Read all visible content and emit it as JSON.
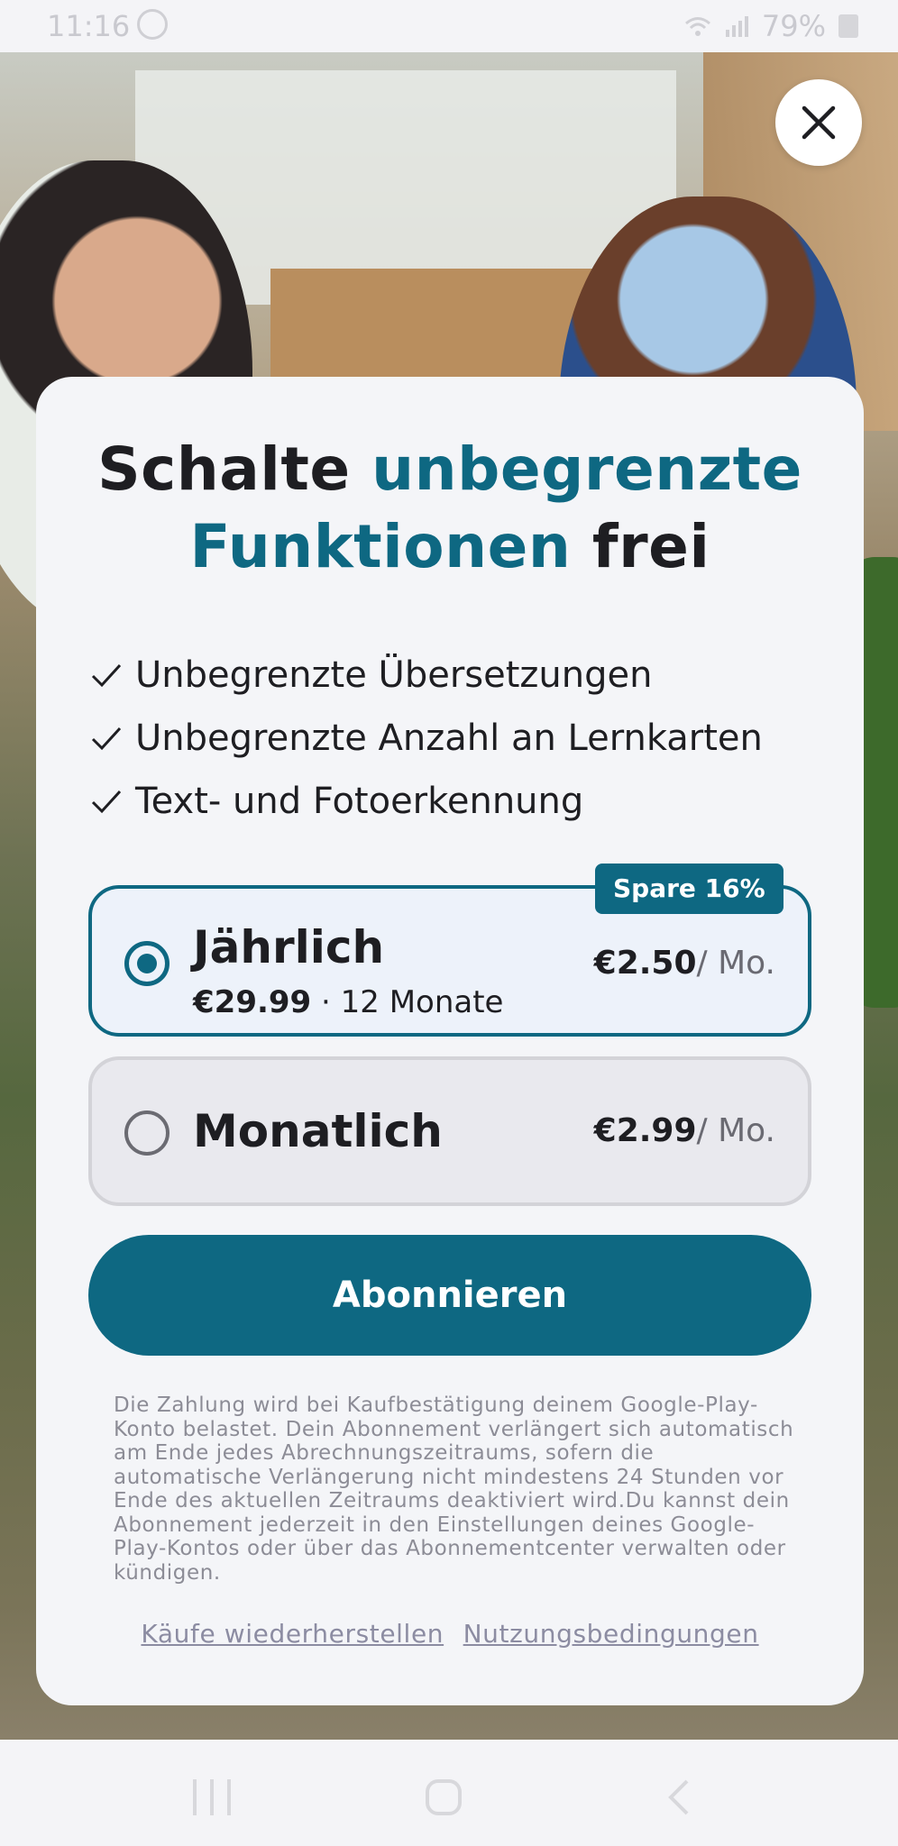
{
  "status": {
    "time": "11:16",
    "battery": "79%"
  },
  "headline": {
    "part1": "Schalte ",
    "accent": "unbegrenzte Funktionen",
    "part2": " frei"
  },
  "benefits": [
    "Unbegrenzte Übersetzungen",
    "Unbegrenzte Anzahl an Lernkarten",
    "Text- und Fotoerkennung"
  ],
  "plans": {
    "yearly": {
      "name": "Jährlich",
      "price_total": "€29.99",
      "duration": " · 12 Monate",
      "price_monthly": "€2.50",
      "unit": "/ Mo.",
      "badge": "Spare 16%",
      "selected": true
    },
    "monthly": {
      "name": "Monatlich",
      "price_monthly": "€2.99",
      "unit": "/ Mo.",
      "selected": false
    }
  },
  "subscribe_label": "Abonnieren",
  "legal_text": "Die Zahlung wird bei Kaufbestätigung deinem Google-Play-Konto belastet. Dein Abonnement verlängert sich automatisch am Ende jedes Abrechnungszeitraums, sofern die automatische Verlängerung nicht mindestens 24 Stunden vor Ende des aktuellen Zeitraums deaktiviert wird.Du kannst dein Abonnement jederzeit in den Einstellungen deines Google-Play-Kontos oder über das Abonnementcenter verwalten oder kündigen.",
  "links": {
    "restore": "Käufe wiederherstellen",
    "terms": "Nutzungsbedingungen"
  },
  "colors": {
    "accent": "#0e6882",
    "card": "#f4f5f8"
  },
  "icons": [
    "close-icon",
    "check-icon",
    "radio-checked-icon",
    "radio-empty-icon",
    "wifi-icon",
    "signal-icon",
    "battery-icon"
  ]
}
